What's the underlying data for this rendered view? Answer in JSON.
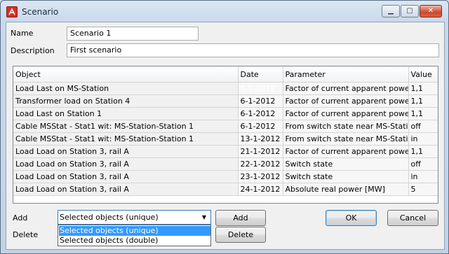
{
  "window": {
    "title": "Scenario",
    "min_symbol": "▁",
    "max_symbol": "▢",
    "close_symbol": "✕"
  },
  "form": {
    "name_label": "Name",
    "name_value": "Scenario 1",
    "description_label": "Description",
    "description_value": "First scenario"
  },
  "table": {
    "columns": [
      "Object",
      "Date",
      "Parameter",
      "Value"
    ],
    "rows": [
      [
        "Load Last on MS-Station",
        "6-1-2012",
        "Factor of current apparent power",
        "1,1"
      ],
      [
        "Transformer load  on Station 4",
        "6-1-2012",
        "Factor of current apparent power",
        "1,1"
      ],
      [
        "Load Last on Station 1",
        "6-1-2012",
        "Factor of current apparent power",
        "1,1"
      ],
      [
        "Cable MSStat - Stat1 wit: MS-Station-Station 1",
        "6-1-2012",
        "From switch state near MS-Station",
        "off"
      ],
      [
        "Cable MSStat - Stat1 wit: MS-Station-Station 1",
        "13-1-2012",
        "From switch state near MS-Station",
        "in"
      ],
      [
        "Load Load on Station 3, rail A",
        "21-1-2012",
        "Factor of current apparent power",
        "1,1"
      ],
      [
        "Load Load on Station 3, rail A",
        "22-1-2012",
        "Switch state",
        "off"
      ],
      [
        "Load Load on Station 3, rail A",
        "23-1-2012",
        "Switch state",
        "in"
      ],
      [
        "Load Load on Station 3, rail A",
        "24-1-2012",
        "Absolute real power [MW]",
        "5"
      ]
    ]
  },
  "bottom": {
    "add_label": "Add",
    "delete_label": "Delete",
    "combo_value": "Selected objects (unique)",
    "combo_options": [
      "Selected objects (unique)",
      "Selected objects (double)"
    ],
    "add_button": "Add",
    "delete_button": "Delete",
    "ok_button": "OK",
    "cancel_button": "Cancel"
  },
  "colors": {
    "selection": "#3399ff",
    "title_bar": "#c9d9ec",
    "close_button": "#c94a2f"
  }
}
